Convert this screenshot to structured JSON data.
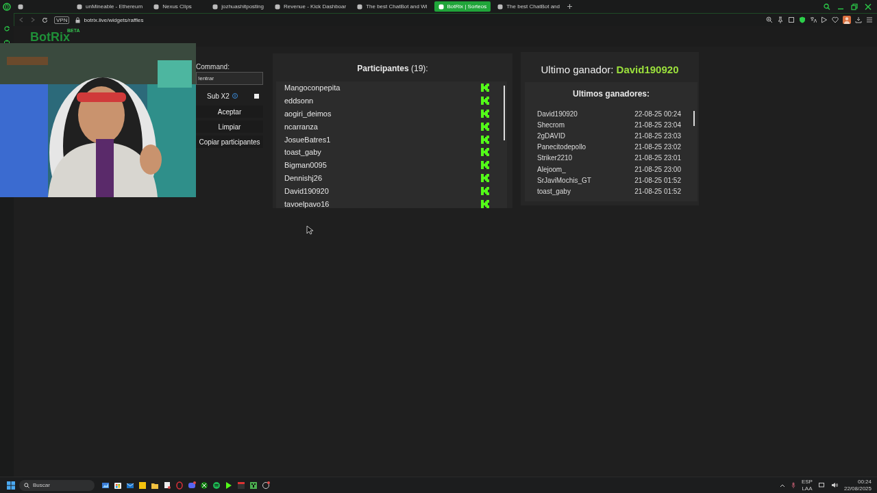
{
  "tabs": [
    {
      "selected": false
    },
    {
      "title": "unMineable - Ethereum",
      "selected": false
    },
    {
      "title": "Nexus Clips",
      "selected": false
    },
    {
      "title": "jozhuashitposting",
      "selected": false
    },
    {
      "title": "Revenue - Kick Dashboar",
      "selected": false
    },
    {
      "title": "The best ChatBot and Wi",
      "selected": false
    },
    {
      "title": "BotRix | Sorteos",
      "selected": true
    },
    {
      "title": "The best ChatBot and",
      "selected": false
    }
  ],
  "address_bar": {
    "vpn": "VPN",
    "url": "botrix.live/widgets/raffles"
  },
  "page": {
    "logo": "BotRix",
    "badge": "BETA",
    "command": {
      "label": "Command:",
      "value": "!entrar"
    },
    "sub_x2": {
      "label": "Sub X2",
      "checked": false
    },
    "buttons": [
      "Aceptar",
      "Limpiar",
      "Copiar participantes"
    ],
    "participants": {
      "title": "Participantes",
      "count": "(19)",
      "suffix": ":",
      "items": [
        "Mangoconpepita",
        "eddsonn",
        "aogiri_deimos",
        "ncarranza",
        "JosueBatres1",
        "toast_gaby",
        "Bigman0095",
        "Dennishj26",
        "David190920",
        "tavoelpavo16"
      ]
    },
    "last_winner": {
      "label": "Ultimo ganador:",
      "name": "David190920"
    },
    "winners": {
      "title": "Ultimos ganadores:",
      "items": [
        {
          "name": "David190920",
          "date": "22-08-25 00:24"
        },
        {
          "name": "Shecrom",
          "date": "21-08-25 23:04"
        },
        {
          "name": "2gDAVID",
          "date": "21-08-25 23:03"
        },
        {
          "name": "Panecitodepollo",
          "date": "21-08-25 23:02"
        },
        {
          "name": "Striker2210",
          "date": "21-08-25 23:01"
        },
        {
          "name": "Alejoom_",
          "date": "21-08-25 23:00"
        },
        {
          "name": "SrJaviMochis_GT",
          "date": "21-08-25 01:52"
        },
        {
          "name": "toast_gaby",
          "date": "21-08-25 01:52"
        }
      ]
    }
  },
  "taskbar": {
    "search_placeholder": "Buscar",
    "language": "ESP",
    "layout": "LAA",
    "time": "00:24",
    "date": "22/08/2025"
  }
}
